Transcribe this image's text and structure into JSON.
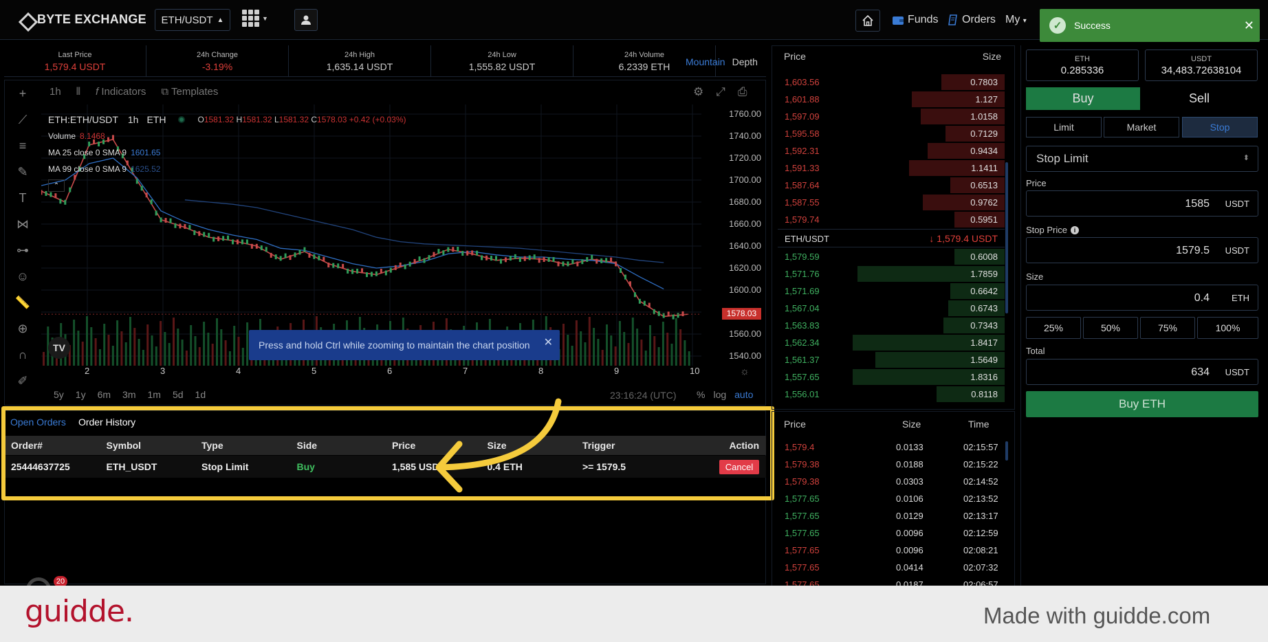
{
  "app": {
    "brand": "BYTE EXCHANGE",
    "pair": "ETH/USDT"
  },
  "nav": {
    "funds": "Funds",
    "orders": "Orders",
    "my": "My"
  },
  "toast": {
    "text": "Success",
    "close": "✕"
  },
  "stats": [
    {
      "label": "Last Price",
      "value": "1,579.4 USDT",
      "tone": "red"
    },
    {
      "label": "24h Change",
      "value": "-3.19%",
      "tone": "red"
    },
    {
      "label": "24h High",
      "value": "1,635.14 USDT",
      "tone": "normal"
    },
    {
      "label": "24h Low",
      "value": "1,555.82 USDT",
      "tone": "normal"
    },
    {
      "label": "24h Volume",
      "value": "6.2339 ETH",
      "tone": "normal"
    }
  ],
  "view_tabs": {
    "mountain": "Mountain",
    "depth": "Depth"
  },
  "chart_toolbar": {
    "interval": "1h",
    "indicators": "Indicators",
    "templates": "Templates"
  },
  "legend": {
    "symbol": "ETH:ETH/USDT",
    "interval": "1h",
    "exchange": "ETH",
    "o_label": "O",
    "o": "1581.32",
    "h_label": "H",
    "h": "1581.32",
    "l_label": "L",
    "l": "1581.32",
    "c_label": "C",
    "c": "1578.03",
    "change": "+0.42 (+0.03%)",
    "volume_label": "Volume",
    "volume": "8.1468",
    "ma25_label": "MA 25 close 0 SMA 9",
    "ma25": "1601.65",
    "ma99_label": "MA 99 close 0 SMA 9",
    "ma99": "1625.52"
  },
  "chart_data": {
    "type": "line",
    "title": "ETH:ETH/USDT",
    "x_ticks": [
      "2",
      "3",
      "4",
      "5",
      "6",
      "7",
      "8",
      "9",
      "10"
    ],
    "y_ticks": [
      "1760.00",
      "1740.00",
      "1720.00",
      "1700.00",
      "1680.00",
      "1660.00",
      "1640.00",
      "1620.00",
      "1600.00",
      "1580.00",
      "1560.00",
      "1540.00"
    ],
    "ylim": [
      1540,
      1760
    ],
    "last_price_tag": "1578.03",
    "series": [
      {
        "name": "Price",
        "values": [
          1690,
          1680,
          1732,
          1737,
          1700,
          1664,
          1657,
          1648,
          1645,
          1640,
          1628,
          1635,
          1624,
          1617,
          1614,
          1621,
          1628,
          1637,
          1633,
          1627,
          1629,
          1628,
          1623,
          1628,
          1625,
          1590,
          1576,
          1578
        ]
      },
      {
        "name": "MA 25 close 0 SMA 9",
        "values": [
          1695,
          1700,
          1715,
          1720,
          1702,
          1672,
          1662,
          1655,
          1650,
          1646,
          1638,
          1636,
          1630,
          1624,
          1620,
          1622,
          1626,
          1633,
          1635,
          1632,
          1630,
          1630,
          1628,
          1627,
          1624,
          1612,
          1601,
          null
        ]
      },
      {
        "name": "MA 99 close 0 SMA 9",
        "values": [
          null,
          null,
          null,
          null,
          null,
          null,
          1682,
          1680,
          1678,
          1675,
          1670,
          1665,
          1660,
          1655,
          1648,
          1644,
          1642,
          1641,
          1640,
          1639,
          1638,
          1636,
          1634,
          1632,
          1630,
          1627,
          1625,
          null
        ]
      }
    ]
  },
  "time_scale": {
    "ranges": [
      "5y",
      "1y",
      "6m",
      "3m",
      "1m",
      "5d",
      "1d"
    ],
    "clock": "23:16:24 (UTC)",
    "pct": "%",
    "log": "log",
    "auto": "auto"
  },
  "zoom_tip": {
    "text": "Press and hold Ctrl while zooming to maintain the chart position",
    "close": "✕"
  },
  "tv_logo": "TV",
  "orders": {
    "tab_open": "Open Orders",
    "tab_history": "Order History",
    "columns": [
      "Order#",
      "Symbol",
      "Type",
      "Side",
      "Price",
      "Size",
      "Trigger",
      "Action"
    ],
    "rows": [
      {
        "order": "25444637725",
        "symbol": "ETH_USDT",
        "type": "Stop Limit",
        "side": "Buy",
        "price": "1,585 USDT",
        "size": "0.4 ETH",
        "trigger": ">= 1579.5",
        "action": "Cancel"
      }
    ]
  },
  "book": {
    "header_price": "Price",
    "header_size": "Size",
    "asks": [
      {
        "price": "1,603.56",
        "size": "0.7803",
        "depth": 0.28
      },
      {
        "price": "1,601.88",
        "size": "1.127",
        "depth": 0.41
      },
      {
        "price": "1,597.09",
        "size": "1.0158",
        "depth": 0.37
      },
      {
        "price": "1,595.58",
        "size": "0.7129",
        "depth": 0.26
      },
      {
        "price": "1,592.31",
        "size": "0.9434",
        "depth": 0.34
      },
      {
        "price": "1,591.33",
        "size": "1.1411",
        "depth": 0.42
      },
      {
        "price": "1,587.64",
        "size": "0.6513",
        "depth": 0.24
      },
      {
        "price": "1,587.55",
        "size": "0.9762",
        "depth": 0.36
      },
      {
        "price": "1,579.74",
        "size": "0.5951",
        "depth": 0.22
      }
    ],
    "mid_pair": "ETH/USDT",
    "mid_price": "↓ 1,579.4 USDT",
    "bids": [
      {
        "price": "1,579.59",
        "size": "0.6008",
        "depth": 0.22
      },
      {
        "price": "1,571.76",
        "size": "1.7859",
        "depth": 0.65
      },
      {
        "price": "1,571.69",
        "size": "0.6642",
        "depth": 0.24
      },
      {
        "price": "1,567.04",
        "size": "0.6743",
        "depth": 0.25
      },
      {
        "price": "1,563.83",
        "size": "0.7343",
        "depth": 0.27
      },
      {
        "price": "1,562.34",
        "size": "1.8417",
        "depth": 0.67
      },
      {
        "price": "1,561.37",
        "size": "1.5649",
        "depth": 0.57
      },
      {
        "price": "1,557.65",
        "size": "1.8316",
        "depth": 0.67
      },
      {
        "price": "1,556.01",
        "size": "0.8118",
        "depth": 0.3
      }
    ]
  },
  "trades": {
    "header": [
      "Price",
      "Size",
      "Time"
    ],
    "rows": [
      {
        "price": "1,579.4",
        "size": "0.0133",
        "time": "02:15:57",
        "side": "sell"
      },
      {
        "price": "1,579.38",
        "size": "0.0188",
        "time": "02:15:22",
        "side": "sell"
      },
      {
        "price": "1,579.38",
        "size": "0.0303",
        "time": "02:14:52",
        "side": "sell"
      },
      {
        "price": "1,577.65",
        "size": "0.0106",
        "time": "02:13:52",
        "side": "buy"
      },
      {
        "price": "1,577.65",
        "size": "0.0129",
        "time": "02:13:17",
        "side": "buy"
      },
      {
        "price": "1,577.65",
        "size": "0.0096",
        "time": "02:12:59",
        "side": "buy"
      },
      {
        "price": "1,577.65",
        "size": "0.0096",
        "time": "02:08:21",
        "side": "sell"
      },
      {
        "price": "1,577.65",
        "size": "0.0414",
        "time": "02:07:32",
        "side": "sell"
      },
      {
        "price": "1,577.65",
        "size": "0.0187",
        "time": "02:06:57",
        "side": "sell"
      }
    ]
  },
  "form": {
    "bal_eth_label": "ETH",
    "bal_eth": "0.285336",
    "bal_usdt_label": "USDT",
    "bal_usdt": "34,483.72638104",
    "buy_tab": "Buy",
    "sell_tab": "Sell",
    "types": [
      "Limit",
      "Market",
      "Stop"
    ],
    "stop_select": "Stop Limit",
    "price_label": "Price",
    "price": "1585",
    "price_unit": "USDT",
    "stop_label": "Stop Price",
    "stop_price": "1579.5",
    "stop_unit": "USDT",
    "size_label": "Size",
    "size": "0.4",
    "size_unit": "ETH",
    "pcts": [
      "25%",
      "50%",
      "75%",
      "100%"
    ],
    "total_label": "Total",
    "total": "634",
    "total_unit": "USDT",
    "submit": "Buy ETH"
  },
  "notification_count": "20",
  "footer": {
    "logo": "guidde.",
    "made_with": "Made with guidde.com"
  },
  "colors": {
    "ask": "#d0413c",
    "bid": "#3fb060",
    "accent": "#3a7bd5",
    "buy": "#1c7a43",
    "highlight": "#f5cb3c",
    "brand": "#b3122c"
  }
}
